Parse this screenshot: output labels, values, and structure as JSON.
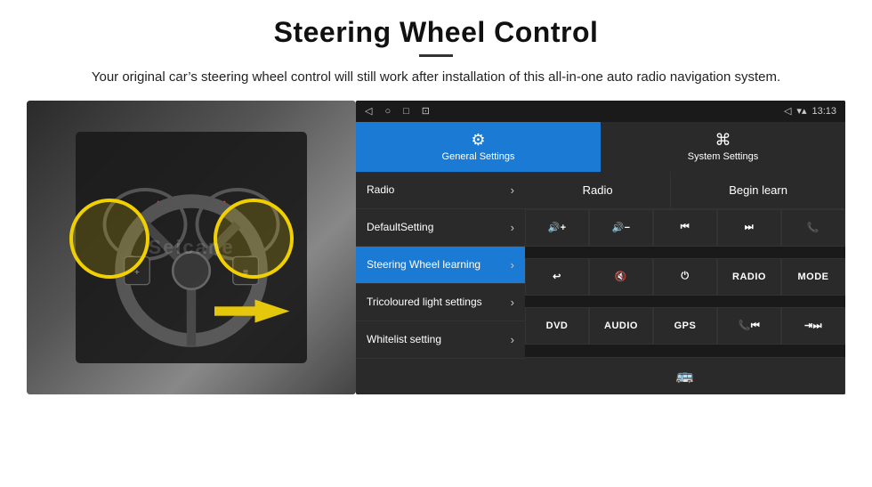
{
  "page": {
    "title": "Steering Wheel Control",
    "subtitle": "Your original car’s steering wheel control will still work after installation of this all-in-one auto radio navigation system.",
    "divider_color": "#333"
  },
  "statusbar": {
    "time": "13:13",
    "icons": {
      "back": "◁",
      "home": "○",
      "recents": "□",
      "cast": "⊡",
      "wifi": "▾▴",
      "signal": "▾▴",
      "location": "△"
    }
  },
  "tabs": {
    "general": {
      "label": "General Settings",
      "icon": "⚙"
    },
    "system": {
      "label": "System Settings",
      "icon": "⌘"
    }
  },
  "menu": {
    "items": [
      {
        "label": "Radio",
        "active": false
      },
      {
        "label": "DefaultSetting",
        "active": false
      },
      {
        "label": "Steering Wheel learning",
        "active": true
      },
      {
        "label": "Tricoloured light settings",
        "active": false
      },
      {
        "label": "Whitelist setting",
        "active": false
      }
    ]
  },
  "controls": {
    "radio_label": "Radio",
    "begin_learn_label": "Begin learn",
    "buttons": [
      {
        "label": "🔊+"
      },
      {
        "label": "🔊−"
      },
      {
        "label": "⧏⧏"
      },
      {
        "label": "⧐⧐"
      },
      {
        "label": "📞"
      },
      {
        "label": "↶"
      },
      {
        "label": "🔇×"
      },
      {
        "label": "⏻"
      },
      {
        "label": "RADIO"
      },
      {
        "label": "MODE"
      },
      {
        "label": "DVD"
      },
      {
        "label": "AUDIO"
      },
      {
        "label": "GPS"
      },
      {
        "label": "📞⧏⧏"
      },
      {
        "label": "⥄⧐"
      }
    ],
    "bottom_icon": "🚌"
  },
  "watermark": "Seicane"
}
